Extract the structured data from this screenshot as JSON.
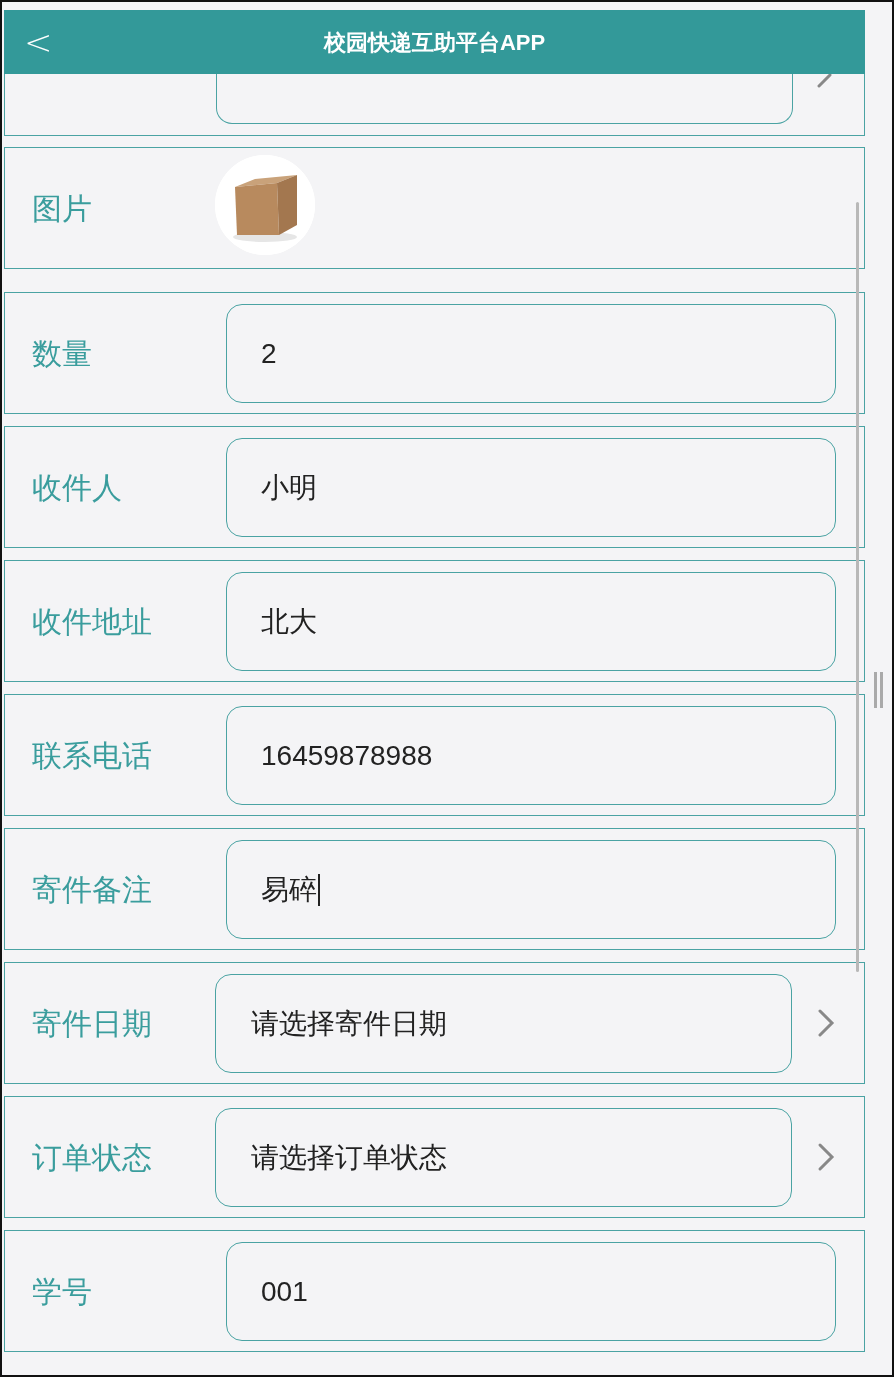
{
  "header": {
    "back": "<",
    "title": "校园快递互助平台APP"
  },
  "rows": [
    {
      "label": "图片"
    },
    {
      "kind": "input",
      "label": "数量",
      "value": "2",
      "focused": false
    },
    {
      "kind": "input",
      "label": "收件人",
      "value": "小明",
      "focused": false
    },
    {
      "kind": "input",
      "label": "收件地址",
      "value": "北大",
      "focused": false
    },
    {
      "kind": "input",
      "label": "联系电话",
      "value": "16459878988",
      "focused": false
    },
    {
      "kind": "input",
      "label": "寄件备注",
      "value": "易碎",
      "focused": true
    },
    {
      "kind": "select",
      "label": "寄件日期",
      "placeholder": "请选择寄件日期"
    },
    {
      "kind": "select",
      "label": "订单状态",
      "placeholder": "请选择订单状态"
    },
    {
      "kind": "input",
      "label": "学号",
      "value": "001",
      "focused": false
    }
  ]
}
